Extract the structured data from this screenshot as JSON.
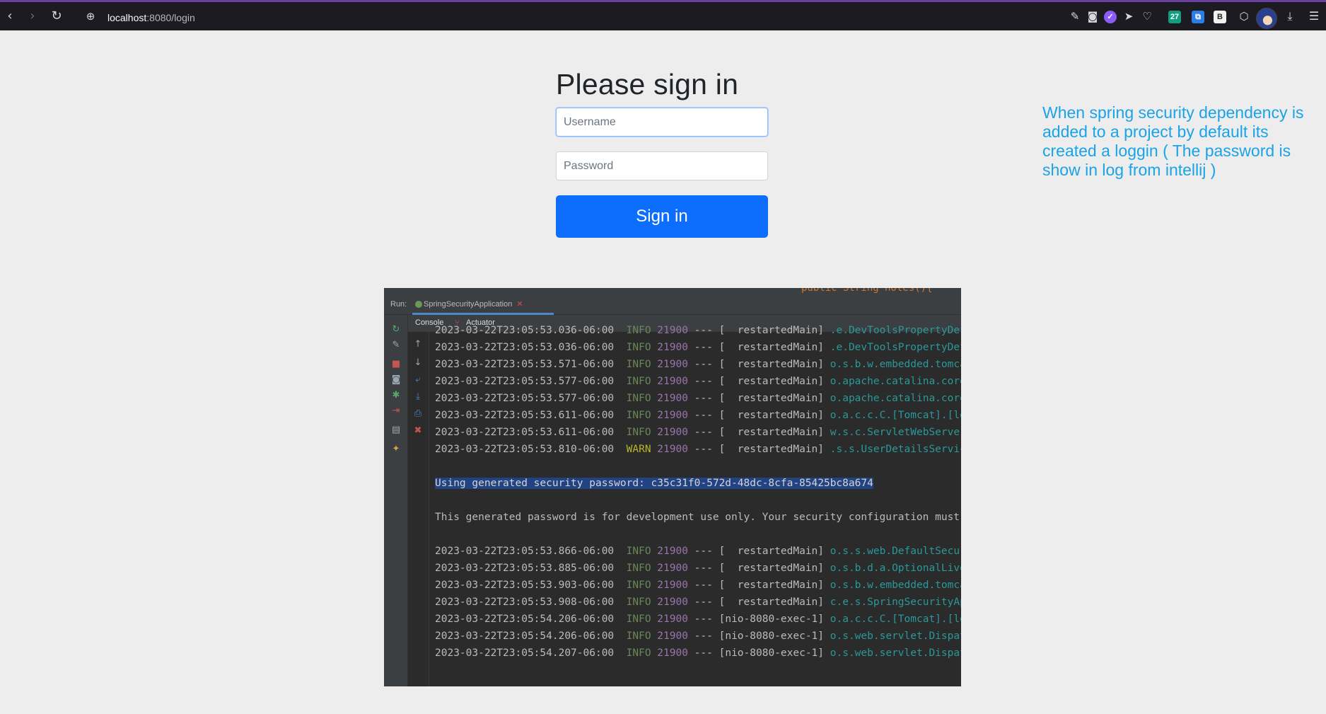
{
  "browser": {
    "url_host": "localhost",
    "url_path": ":8080/login",
    "extensions": [
      {
        "icon": "screenshot-icon"
      },
      {
        "icon": "camera-icon"
      },
      {
        "icon": "shield-extension-icon",
        "color": "#8b5cf6"
      },
      {
        "icon": "send-icon"
      },
      {
        "icon": "heart-icon"
      },
      {
        "label": "27",
        "color": "#129e7e"
      },
      {
        "icon": "translate-extension-icon",
        "color": "#2b7de9"
      },
      {
        "label": "B",
        "color": "#f0f0f0"
      },
      {
        "icon": "cube-icon"
      }
    ]
  },
  "form": {
    "heading": "Please sign in",
    "username_placeholder": "Username",
    "password_placeholder": "Password",
    "signin_label": "Sign in"
  },
  "annotation": "When spring security dependency is added to a project by default its created a loggin ( The password is show in log from intellij )",
  "ide": {
    "top_code": "public String notes(){",
    "run_label": "Run:",
    "run_tab": "SpringSecurityApplication",
    "subtabs": [
      "Console",
      "Actuator"
    ],
    "log_lines": [
      {
        "ts": "2023-03-22T23:05:53.036-06:00",
        "level": "INFO",
        "pid": "21900",
        "sep": " --- [",
        "thread": "  restartedMain",
        "close": "] ",
        "logger": ".e.DevToolsPropertyDefaultsPostProcessor"
      },
      {
        "ts": "2023-03-22T23:05:53.036-06:00",
        "level": "INFO",
        "pid": "21900",
        "sep": " --- [",
        "thread": "  restartedMain",
        "close": "] ",
        "logger": ".e.DevToolsPropertyDefaultsPostProcessor"
      },
      {
        "ts": "2023-03-22T23:05:53.571-06:00",
        "level": "INFO",
        "pid": "21900",
        "sep": " --- [",
        "thread": "  restartedMain",
        "close": "] ",
        "logger": "o.s.b.w.embedded.tomcat.TomcatWebServer"
      },
      {
        "ts": "2023-03-22T23:05:53.577-06:00",
        "level": "INFO",
        "pid": "21900",
        "sep": " --- [",
        "thread": "  restartedMain",
        "close": "] ",
        "logger": "o.apache.catalina.core.StandardService"
      },
      {
        "ts": "2023-03-22T23:05:53.577-06:00",
        "level": "INFO",
        "pid": "21900",
        "sep": " --- [",
        "thread": "  restartedMain",
        "close": "] ",
        "logger": "o.apache.catalina.core.StandardEngine"
      },
      {
        "ts": "2023-03-22T23:05:53.611-06:00",
        "level": "INFO",
        "pid": "21900",
        "sep": " --- [",
        "thread": "  restartedMain",
        "close": "] ",
        "logger": "o.a.c.c.C.[Tomcat].[localhost].[/]"
      },
      {
        "ts": "2023-03-22T23:05:53.611-06:00",
        "level": "INFO",
        "pid": "21900",
        "sep": " --- [",
        "thread": "  restartedMain",
        "close": "] ",
        "logger": "w.s.c.ServletWebServerApplicationContext"
      },
      {
        "ts": "2023-03-22T23:05:53.810-06:00",
        "level": "WARN",
        "pid": "21900",
        "sep": " --- [",
        "thread": "  restartedMain",
        "close": "] ",
        "logger": ".s.s.UserDetailsServiceAutoConfiguration"
      },
      {
        "blank": true
      },
      {
        "text": "Using generated security password: c35c31f0-572d-48dc-8cfa-85425bc8a674",
        "selected": true
      },
      {
        "blank": true
      },
      {
        "text": "This generated password is for development use only. Your security configuration must be updated before running your application in production."
      },
      {
        "blank": true
      },
      {
        "ts": "2023-03-22T23:05:53.866-06:00",
        "level": "INFO",
        "pid": "21900",
        "sep": " --- [",
        "thread": "  restartedMain",
        "close": "] ",
        "logger": "o.s.s.web.DefaultSecurityFilterChain"
      },
      {
        "ts": "2023-03-22T23:05:53.885-06:00",
        "level": "INFO",
        "pid": "21900",
        "sep": " --- [",
        "thread": "  restartedMain",
        "close": "] ",
        "logger": "o.s.b.d.a.OptionalLiveReloadServer"
      },
      {
        "ts": "2023-03-22T23:05:53.903-06:00",
        "level": "INFO",
        "pid": "21900",
        "sep": " --- [",
        "thread": "  restartedMain",
        "close": "] ",
        "logger": "o.s.b.w.embedded.tomcat.TomcatWebServer"
      },
      {
        "ts": "2023-03-22T23:05:53.908-06:00",
        "level": "INFO",
        "pid": "21900",
        "sep": " --- [",
        "thread": "  restartedMain",
        "close": "] ",
        "logger": "c.e.s.SpringSecurityApplication"
      },
      {
        "ts": "2023-03-22T23:05:54.206-06:00",
        "level": "INFO",
        "pid": "21900",
        "sep": " --- [",
        "thread": "nio-8080-exec-1",
        "close": "] ",
        "logger": "o.a.c.c.C.[Tomcat].[localhost].[/]"
      },
      {
        "ts": "2023-03-22T23:05:54.206-06:00",
        "level": "INFO",
        "pid": "21900",
        "sep": " --- [",
        "thread": "nio-8080-exec-1",
        "close": "] ",
        "logger": "o.s.web.servlet.DispatcherServlet"
      },
      {
        "ts": "2023-03-22T23:05:54.207-06:00",
        "level": "INFO",
        "pid": "21900",
        "sep": " --- [",
        "thread": "nio-8080-exec-1",
        "close": "] ",
        "logger": "o.s.web.servlet.DispatcherServlet"
      }
    ]
  }
}
